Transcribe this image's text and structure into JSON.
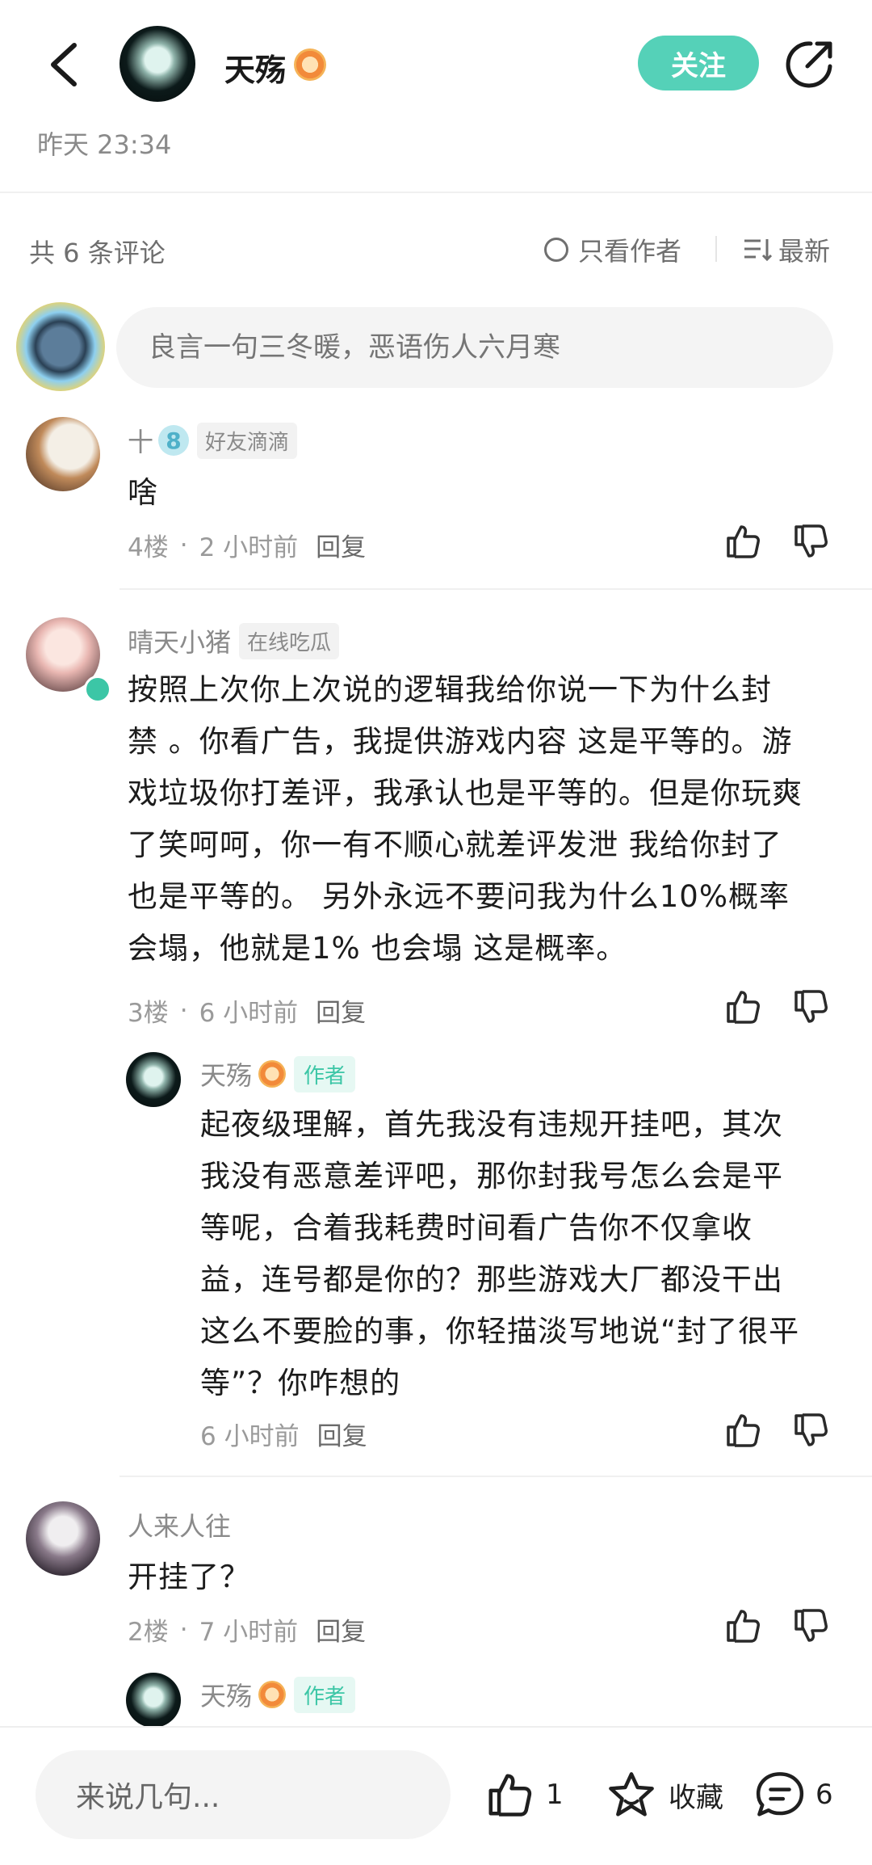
{
  "header": {
    "author_name": "天殇",
    "follow_label": "关注",
    "post_time": "昨天 23:34"
  },
  "comments_header": {
    "count_label": "共 6 条评论",
    "only_author_label": "只看作者",
    "sort_label": "最新"
  },
  "composer": {
    "placeholder": "良言一句三冬暖，恶语伤人六月寒"
  },
  "comments": [
    {
      "name": "十",
      "tag": "好友滴滴",
      "text": "啥",
      "floor": "4楼",
      "time": "2 小时前",
      "reply": "回复"
    },
    {
      "name": "晴天小猪",
      "tag": "在线吃瓜",
      "lines": [
        "按照上次你上次说的逻辑我给你说一下为什么封",
        "禁 。你看广告，我提供游戏内容  这是平等的。游",
        "戏垃圾你打差评，我承认也是平等的。但是你玩爽",
        "了笑呵呵，你一有不顺心就差评发泄  我给你封了",
        "也是平等的。 另外永远不要问我为什么10%概率",
        "会塌，他就是1% 也会塌  这是概率。"
      ],
      "floor": "3楼",
      "time": "6 小时前",
      "reply": "回复",
      "author_reply": {
        "name": "天殇",
        "tag": "作者",
        "lines": [
          "起夜级理解，首先我没有违规开挂吧，其次",
          "我没有恶意差评吧，那你封我号怎么会是平",
          "等呢，合着我耗费时间看广告你不仅拿收",
          "益，连号都是你的？那些游戏大厂都没干出",
          "这么不要脸的事，你轻描淡写地说“封了很平",
          "等”？你咋想的"
        ],
        "time": "6 小时前",
        "reply": "回复"
      }
    },
    {
      "name": "人来人往",
      "text": "开挂了？",
      "floor": "2楼",
      "time": "7 小时前",
      "reply": "回复",
      "author_reply": {
        "name": "天殇",
        "tag": "作者"
      }
    }
  ],
  "bottom_bar": {
    "placeholder": "来说几句...",
    "like_count": "1",
    "collect_label": "收藏",
    "comment_count": "6"
  },
  "colors": {
    "accent": "#55d1b8",
    "author_tag": "#3cc6a6"
  }
}
